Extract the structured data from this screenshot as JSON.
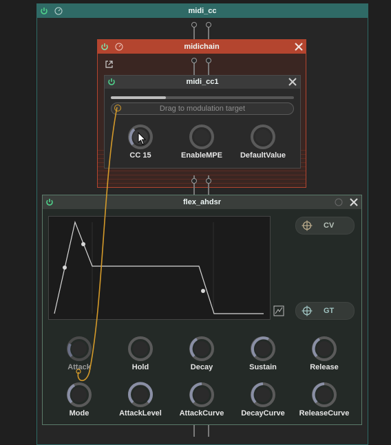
{
  "outer": {
    "title": "midi_cc"
  },
  "chain": {
    "title": "midichain"
  },
  "cc1": {
    "title": "midi_cc1",
    "progress_fraction": 0.3,
    "drag_text": "Drag to modulation target",
    "knobs": [
      {
        "label": "CC 15"
      },
      {
        "label": "EnableMPE"
      },
      {
        "label": "DefaultValue"
      }
    ]
  },
  "ahdsr": {
    "title": "flex_ahdsr",
    "cv_label": "CV",
    "gt_label": "GT",
    "knobs_row1": [
      {
        "label": "Attack"
      },
      {
        "label": "Hold"
      },
      {
        "label": "Decay"
      },
      {
        "label": "Sustain"
      },
      {
        "label": "Release"
      }
    ],
    "knobs_row2": [
      {
        "label": "Mode"
      },
      {
        "label": "AttackLevel"
      },
      {
        "label": "AttackCurve"
      },
      {
        "label": "DecayCurve"
      },
      {
        "label": "ReleaseCurve"
      }
    ]
  },
  "colors": {
    "accent_teal": "#2f6a66",
    "chain_orange": "#b4452f",
    "power_green": "#4fd08a",
    "cable_orange": "#d49a2a"
  }
}
